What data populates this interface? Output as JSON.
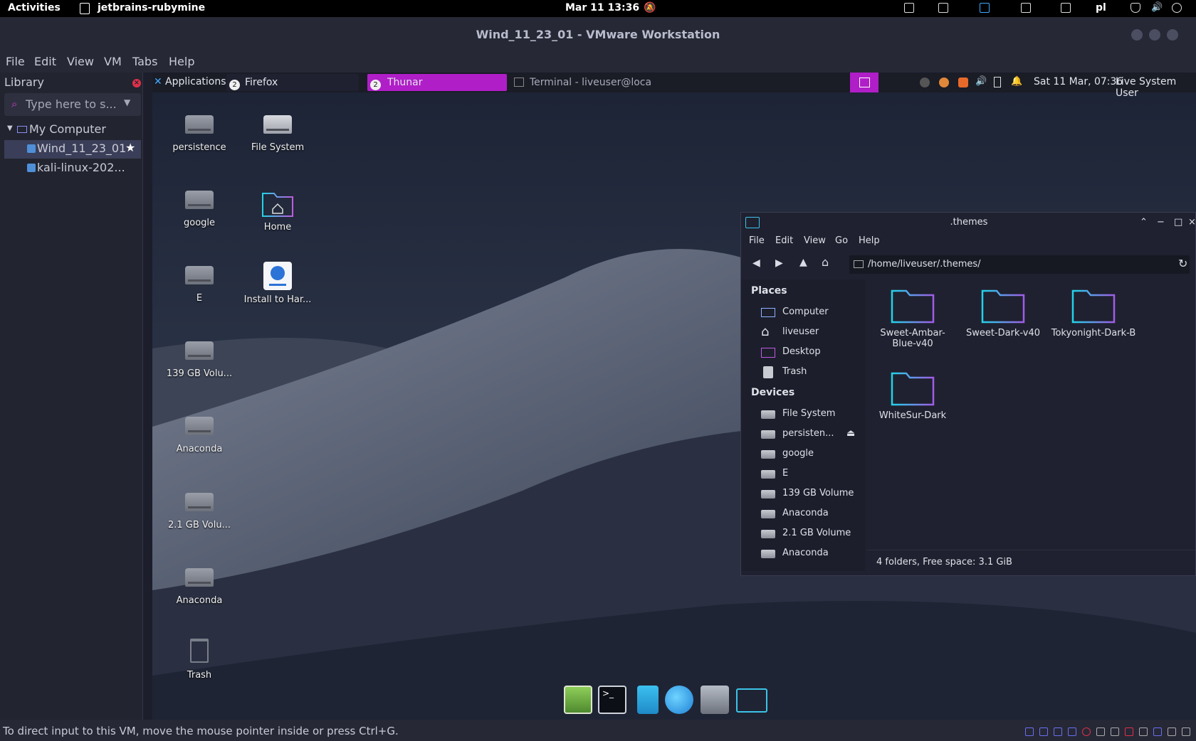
{
  "gnome_bar": {
    "activities": "Activities",
    "app_name": "jetbrains-rubymine",
    "clock": "Mar 11  13:36",
    "language": "pl"
  },
  "vmware": {
    "title": "Wind_11_23_01 - VMware Workstation",
    "menu": [
      "File",
      "Edit",
      "View",
      "VM",
      "Tabs",
      "Help"
    ],
    "library": {
      "title": "Library",
      "search_placeholder": "Type here to s...",
      "tree": [
        "My Computer",
        "Wind_11_23_01",
        "kali-linux-202..."
      ]
    },
    "status_text": "To direct input to this VM, move the mouse pointer inside or press Ctrl+G."
  },
  "xfce_panel": {
    "applications": "Applications",
    "tasks": [
      {
        "label": "Firefox",
        "count": "2"
      },
      {
        "label": "Thunar",
        "count": "2"
      },
      {
        "label": "Terminal - liveuser@localh..."
      }
    ],
    "clock": "Sat 11 Mar, 07:36",
    "user": "Live System User"
  },
  "desktop": {
    "col1": [
      "persistence",
      "google",
      "E",
      "139 GB Volu...",
      "Anaconda",
      "2.1 GB Volu...",
      "Anaconda",
      "Trash"
    ],
    "col2": [
      "File System",
      "Home",
      "Install to Har..."
    ]
  },
  "thunar": {
    "title": ".themes",
    "menu": [
      "File",
      "Edit",
      "View",
      "Go",
      "Help"
    ],
    "path": "/home/liveuser/.themes/",
    "places_header": "Places",
    "places": [
      "Computer",
      "liveuser",
      "Desktop",
      "Trash"
    ],
    "devices_header": "Devices",
    "devices": [
      "File System",
      "persisten...",
      "google",
      "E",
      "139 GB Volume",
      "Anaconda",
      "2.1 GB Volume",
      "Anaconda"
    ],
    "folders": [
      "Sweet-Ambar-Blue-v40",
      "Sweet-Dark-v40",
      "Tokyonight-Dark-B",
      "WhiteSur-Dark"
    ],
    "status": "4 folders, Free space: 3.1 GiB"
  },
  "colors": {
    "accent_magenta": "#b01ec8",
    "accent_cyan": "#1fb6d6",
    "folder_gradient_start": "#22d3e8",
    "folder_gradient_end": "#a15ce8"
  }
}
